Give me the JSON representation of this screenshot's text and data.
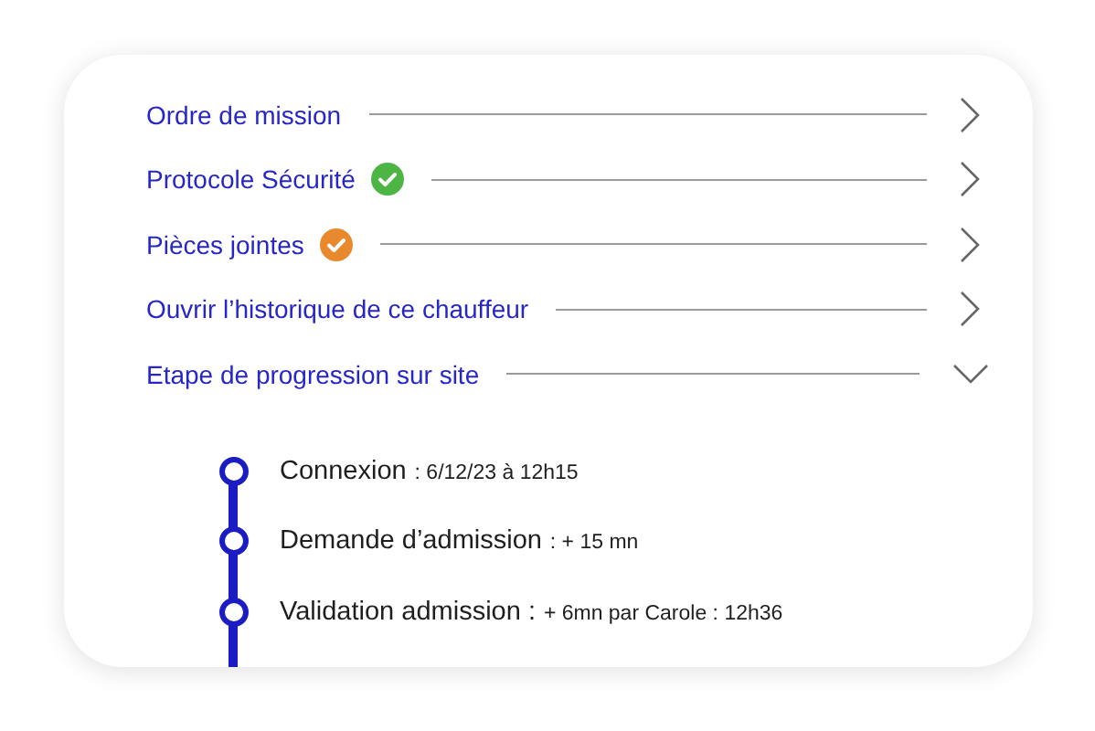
{
  "menu_items": [
    {
      "label": "Ordre de mission",
      "expanded": false
    },
    {
      "label": "Protocole Sécurité",
      "color": "#4cb543",
      "expanded": false
    },
    {
      "label": "Pièces jointes",
      "color": "#e8892e",
      "expanded": false
    },
    {
      "label": "Ouvrir l’historique de ce chauffeur",
      "expanded": false
    },
    {
      "label": "Etape de progression sur site",
      "expanded": true
    }
  ],
  "timeline": [
    {
      "title": "Connexion",
      "detail": ": 6/12/23 à 12h15"
    },
    {
      "title": "Demande d’admission",
      "detail": ": + 15 mn"
    },
    {
      "title": "Validation admission :",
      "detail": "+ 6mn par Carole : 12h36"
    }
  ]
}
